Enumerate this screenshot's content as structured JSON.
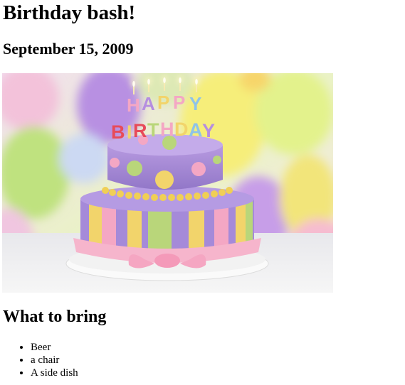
{
  "page": {
    "title": "Birthday bash!",
    "date": "September 15, 2009",
    "section_heading": "What to bring",
    "items": [
      "Beer",
      "a chair",
      "A side dish"
    ]
  },
  "image": {
    "subject": "birthday-cake",
    "cake_candles_text": "HAPPY BIRTHDAY",
    "colors": {
      "cake_top": "#a98ad6",
      "cake_bottom_pink": "#f4a7c4",
      "stripe_yellow": "#f2d46b",
      "stripe_green": "#b9d67a",
      "ribbon_pink": "#f6b5cc",
      "plate": "#f4f4f4",
      "balloon_purple": "#b08be0",
      "balloon_yellow": "#f3ea6a",
      "balloon_green": "#b6e07a",
      "balloon_pink": "#f5b3c8"
    }
  }
}
